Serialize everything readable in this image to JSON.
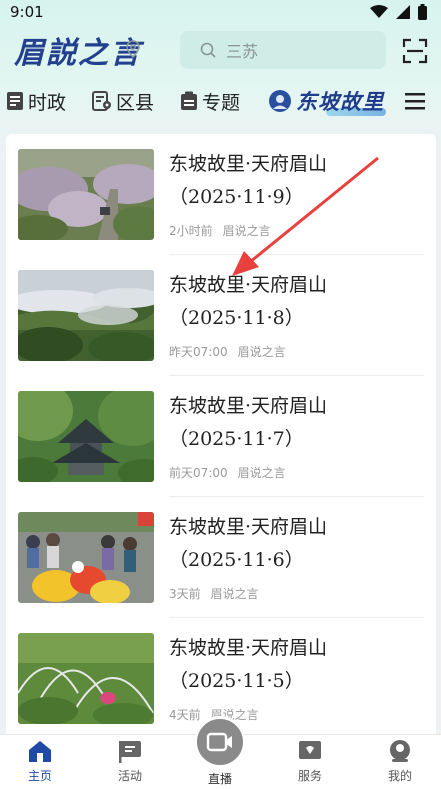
{
  "status_bar": {
    "time": "9:01"
  },
  "header": {
    "logo_text": "眉説之言",
    "search_placeholder": "三苏"
  },
  "tabs": [
    {
      "label": "时政"
    },
    {
      "label": "区县"
    },
    {
      "label": "专题"
    }
  ],
  "brand_tab": {
    "label": "东坡故里"
  },
  "articles": [
    {
      "title_line1": "东坡故里·天府眉山",
      "title_line2": "（2025·11·9）",
      "time": "2小时前",
      "source": "眉说之言"
    },
    {
      "title_line1": "东坡故里·天府眉山",
      "title_line2": "（2025·11·8）",
      "time": "昨天07:00",
      "source": "眉说之言"
    },
    {
      "title_line1": "东坡故里·天府眉山",
      "title_line2": "（2025·11·7）",
      "time": "前天07:00",
      "source": "眉说之言"
    },
    {
      "title_line1": "东坡故里·天府眉山",
      "title_line2": "（2025·11·6）",
      "time": "3天前",
      "source": "眉说之言"
    },
    {
      "title_line1": "东坡故里·天府眉山",
      "title_line2": "（2025·11·5）",
      "time": "4天前",
      "source": "眉说之言"
    }
  ],
  "bottom_nav": {
    "home": "主页",
    "activity": "活动",
    "live": "直播",
    "service": "服务",
    "mine": "我的"
  },
  "colors": {
    "accent": "#1f4aa8",
    "header_bg": "#d7f3ee",
    "arrow": "#e8403c"
  }
}
